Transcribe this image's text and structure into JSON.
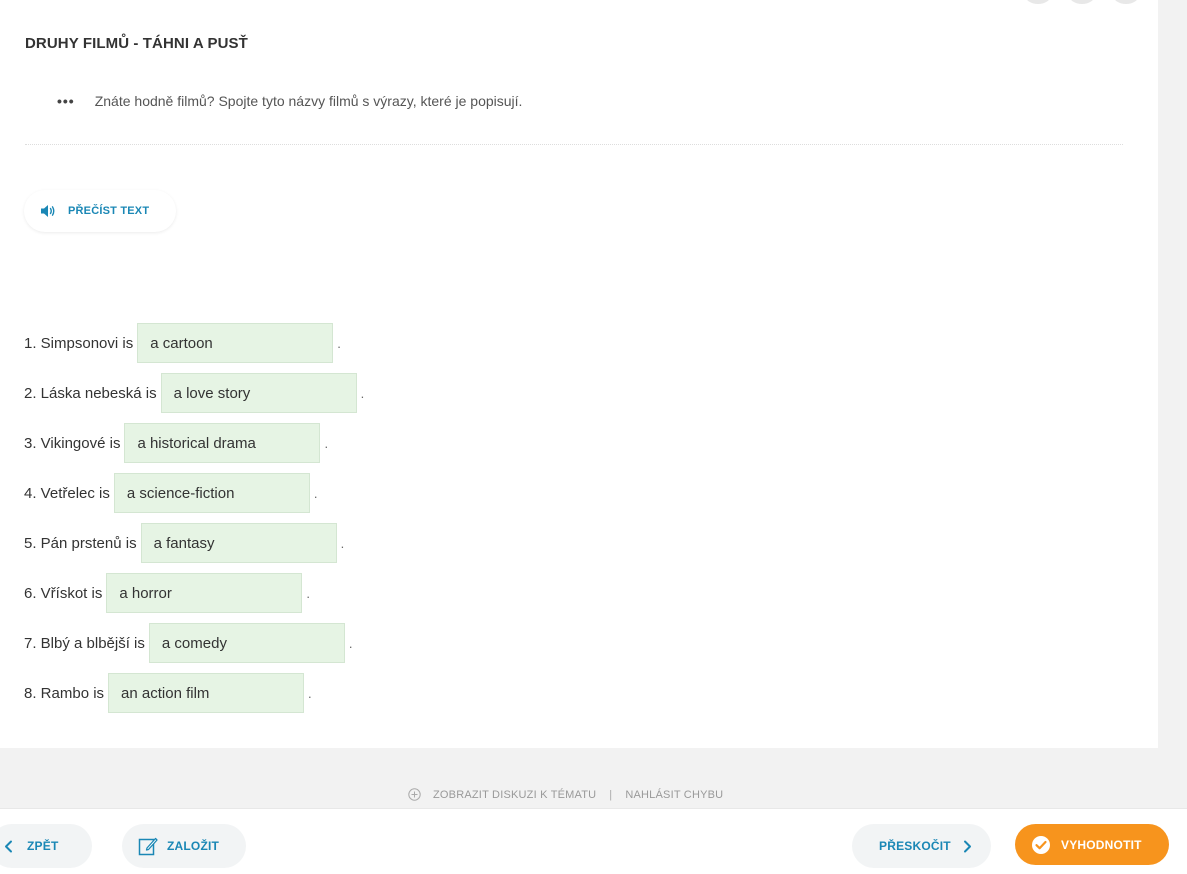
{
  "exercise": {
    "title": "DRUHY FILMŮ - TÁHNI A PUSŤ",
    "instruction": "Znáte hodně filmů? Spojte tyto názvy filmů s výrazy, které je popisují.",
    "dots": "•••",
    "read_text_label": "PŘEČÍST TEXT"
  },
  "sentences": [
    {
      "prefix": "1. Simpsonovi is",
      "answer": "a cartoon",
      "suffix": "."
    },
    {
      "prefix": "2. Láska nebeská is",
      "answer": "a love story",
      "suffix": "."
    },
    {
      "prefix": "3. Vikingové is",
      "answer": "a historical drama",
      "suffix": "."
    },
    {
      "prefix": "4. Vetřelec is",
      "answer": "a science-fiction",
      "suffix": "."
    },
    {
      "prefix": "5. Pán prstenů is",
      "answer": "a fantasy",
      "suffix": "."
    },
    {
      "prefix": "6. Vřískot is",
      "answer": "a horror",
      "suffix": "."
    },
    {
      "prefix": "7. Blbý a blbější is",
      "answer": "a comedy",
      "suffix": "."
    },
    {
      "prefix": "8. Rambo is",
      "answer": "an action film",
      "suffix": "."
    }
  ],
  "footer": {
    "discussion_label": "ZOBRAZIT DISKUZI K TÉMATU",
    "separator": "|",
    "report_label": "NAHLÁSIT CHYBU"
  },
  "nav": {
    "back_label": "ZPĚT",
    "save_label": "ZALOŽIT",
    "skip_label": "PŘESKOČIT",
    "evaluate_label": "VYHODNOTIT"
  },
  "colors": {
    "accent": "#1a87b5",
    "evaluate": "#f7941d",
    "answer_bg": "#e6f4e4"
  }
}
